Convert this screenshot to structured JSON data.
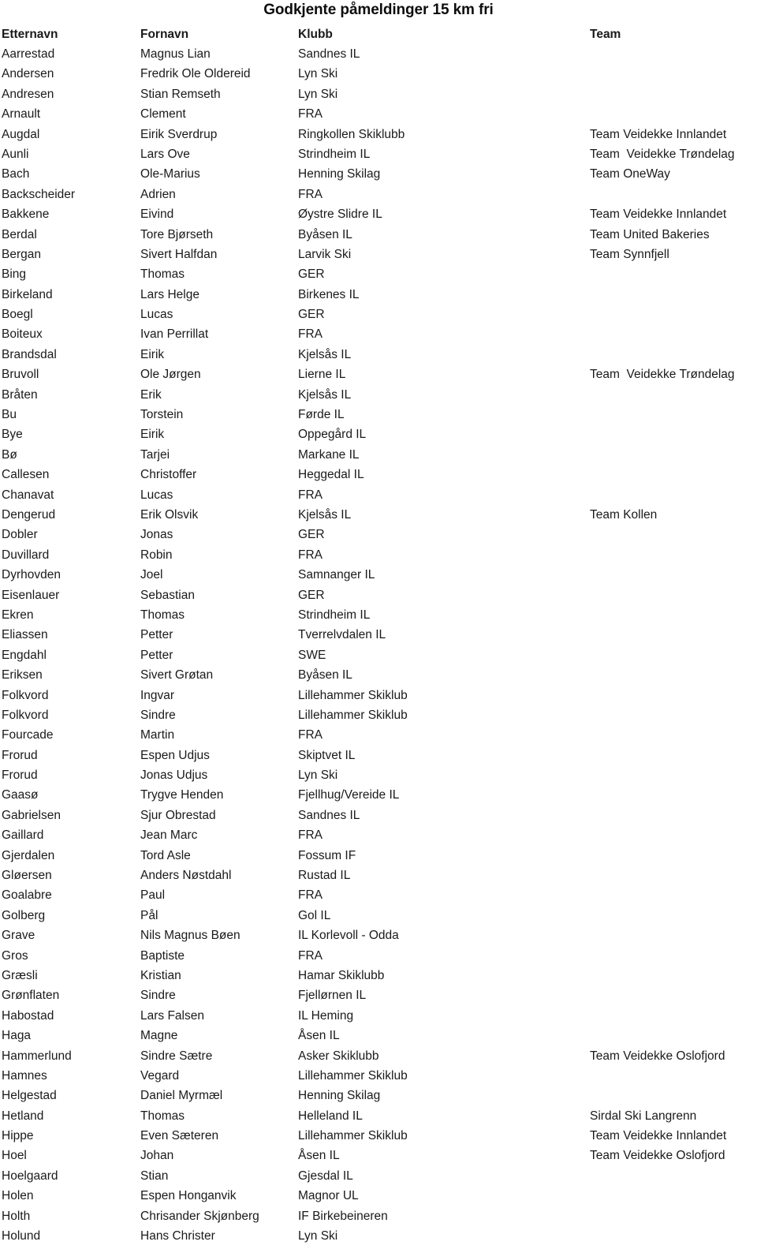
{
  "document": {
    "title": "Godkjente påmeldinger 15 km fri"
  },
  "table": {
    "columns": [
      {
        "key": "etternavn",
        "label": "Etternavn"
      },
      {
        "key": "fornavn",
        "label": "Fornavn"
      },
      {
        "key": "klubb",
        "label": "Klubb"
      },
      {
        "key": "team",
        "label": "Team"
      }
    ],
    "rows": [
      {
        "etternavn": "Aarrestad",
        "fornavn": "Magnus Lian",
        "klubb": "Sandnes IL",
        "team": ""
      },
      {
        "etternavn": "Andersen",
        "fornavn": "Fredrik Ole Oldereid",
        "klubb": "Lyn Ski",
        "team": ""
      },
      {
        "etternavn": "Andresen",
        "fornavn": "Stian Remseth",
        "klubb": "Lyn Ski",
        "team": ""
      },
      {
        "etternavn": "Arnault",
        "fornavn": "Clement",
        "klubb": "FRA",
        "team": ""
      },
      {
        "etternavn": "Augdal",
        "fornavn": "Eirik Sverdrup",
        "klubb": "Ringkollen Skiklubb",
        "team": "Team Veidekke Innlandet"
      },
      {
        "etternavn": "Aunli",
        "fornavn": "Lars Ove",
        "klubb": "Strindheim IL",
        "team": "Team  Veidekke Trøndelag"
      },
      {
        "etternavn": "Bach",
        "fornavn": "Ole-Marius",
        "klubb": "Henning Skilag",
        "team": "Team OneWay"
      },
      {
        "etternavn": "Backscheider",
        "fornavn": "Adrien",
        "klubb": "FRA",
        "team": ""
      },
      {
        "etternavn": "Bakkene",
        "fornavn": "Eivind",
        "klubb": "Øystre Slidre IL",
        "team": "Team Veidekke Innlandet"
      },
      {
        "etternavn": "Berdal",
        "fornavn": "Tore Bjørseth",
        "klubb": "Byåsen IL",
        "team": "Team United Bakeries"
      },
      {
        "etternavn": "Bergan",
        "fornavn": "Sivert Halfdan",
        "klubb": "Larvik Ski",
        "team": "Team Synnfjell"
      },
      {
        "etternavn": "Bing",
        "fornavn": "Thomas",
        "klubb": "GER",
        "team": ""
      },
      {
        "etternavn": "Birkeland",
        "fornavn": "Lars Helge",
        "klubb": "Birkenes IL",
        "team": ""
      },
      {
        "etternavn": "Boegl",
        "fornavn": "Lucas",
        "klubb": "GER",
        "team": ""
      },
      {
        "etternavn": "Boiteux",
        "fornavn": "Ivan Perrillat",
        "klubb": "FRA",
        "team": ""
      },
      {
        "etternavn": "Brandsdal",
        "fornavn": "Eirik",
        "klubb": "Kjelsås IL",
        "team": ""
      },
      {
        "etternavn": "Bruvoll",
        "fornavn": "Ole Jørgen",
        "klubb": "Lierne IL",
        "team": "Team  Veidekke Trøndelag"
      },
      {
        "etternavn": "Bråten",
        "fornavn": "Erik",
        "klubb": "Kjelsås IL",
        "team": ""
      },
      {
        "etternavn": "Bu",
        "fornavn": "Torstein",
        "klubb": "Førde IL",
        "team": ""
      },
      {
        "etternavn": "Bye",
        "fornavn": "Eirik",
        "klubb": "Oppegård IL",
        "team": ""
      },
      {
        "etternavn": "Bø",
        "fornavn": "Tarjei",
        "klubb": "Markane IL",
        "team": ""
      },
      {
        "etternavn": "Callesen",
        "fornavn": "Christoffer",
        "klubb": "Heggedal IL",
        "team": ""
      },
      {
        "etternavn": "Chanavat",
        "fornavn": "Lucas",
        "klubb": "FRA",
        "team": ""
      },
      {
        "etternavn": "Dengerud",
        "fornavn": "Erik Olsvik",
        "klubb": "Kjelsås IL",
        "team": "Team Kollen"
      },
      {
        "etternavn": "Dobler",
        "fornavn": "Jonas",
        "klubb": "GER",
        "team": ""
      },
      {
        "etternavn": "Duvillard",
        "fornavn": "Robin",
        "klubb": "FRA",
        "team": ""
      },
      {
        "etternavn": "Dyrhovden",
        "fornavn": "Joel",
        "klubb": "Samnanger IL",
        "team": ""
      },
      {
        "etternavn": "Eisenlauer",
        "fornavn": "Sebastian",
        "klubb": "GER",
        "team": ""
      },
      {
        "etternavn": "Ekren",
        "fornavn": "Thomas",
        "klubb": "Strindheim IL",
        "team": ""
      },
      {
        "etternavn": "Eliassen",
        "fornavn": "Petter",
        "klubb": "Tverrelvdalen IL",
        "team": ""
      },
      {
        "etternavn": "Engdahl",
        "fornavn": "Petter",
        "klubb": "SWE",
        "team": ""
      },
      {
        "etternavn": "Eriksen",
        "fornavn": "Sivert Grøtan",
        "klubb": "Byåsen IL",
        "team": ""
      },
      {
        "etternavn": "Folkvord",
        "fornavn": "Ingvar",
        "klubb": "Lillehammer Skiklub",
        "team": ""
      },
      {
        "etternavn": "Folkvord",
        "fornavn": "Sindre",
        "klubb": "Lillehammer Skiklub",
        "team": ""
      },
      {
        "etternavn": "Fourcade",
        "fornavn": "Martin",
        "klubb": "FRA",
        "team": ""
      },
      {
        "etternavn": "Frorud",
        "fornavn": "Espen Udjus",
        "klubb": "Skiptvet IL",
        "team": ""
      },
      {
        "etternavn": "Frorud",
        "fornavn": "Jonas Udjus",
        "klubb": "Lyn Ski",
        "team": ""
      },
      {
        "etternavn": "Gaasø",
        "fornavn": "Trygve Henden",
        "klubb": "Fjellhug/Vereide IL",
        "team": ""
      },
      {
        "etternavn": "Gabrielsen",
        "fornavn": "Sjur Obrestad",
        "klubb": "Sandnes IL",
        "team": ""
      },
      {
        "etternavn": "Gaillard",
        "fornavn": "Jean Marc",
        "klubb": "FRA",
        "team": ""
      },
      {
        "etternavn": "Gjerdalen",
        "fornavn": "Tord Asle",
        "klubb": "Fossum IF",
        "team": ""
      },
      {
        "etternavn": "Gløersen",
        "fornavn": "Anders Nøstdahl",
        "klubb": "Rustad IL",
        "team": ""
      },
      {
        "etternavn": "Goalabre",
        "fornavn": "Paul",
        "klubb": "FRA",
        "team": ""
      },
      {
        "etternavn": "Golberg",
        "fornavn": "Pål",
        "klubb": "Gol IL",
        "team": ""
      },
      {
        "etternavn": "Grave",
        "fornavn": "Nils Magnus Bøen",
        "klubb": "IL Korlevoll - Odda",
        "team": ""
      },
      {
        "etternavn": "Gros",
        "fornavn": "Baptiste",
        "klubb": "FRA",
        "team": ""
      },
      {
        "etternavn": "Græsli",
        "fornavn": "Kristian",
        "klubb": "Hamar Skiklubb",
        "team": ""
      },
      {
        "etternavn": "Grønflaten",
        "fornavn": "Sindre",
        "klubb": "Fjellørnen IL",
        "team": ""
      },
      {
        "etternavn": "Habostad",
        "fornavn": "Lars Falsen",
        "klubb": "IL Heming",
        "team": ""
      },
      {
        "etternavn": "Haga",
        "fornavn": "Magne",
        "klubb": "Åsen IL",
        "team": ""
      },
      {
        "etternavn": "Hammerlund",
        "fornavn": "Sindre Sætre",
        "klubb": "Asker Skiklubb",
        "team": "Team Veidekke Oslofjord"
      },
      {
        "etternavn": "Hamnes",
        "fornavn": "Vegard",
        "klubb": "Lillehammer Skiklub",
        "team": ""
      },
      {
        "etternavn": "Helgestad",
        "fornavn": "Daniel Myrmæl",
        "klubb": "Henning Skilag",
        "team": ""
      },
      {
        "etternavn": "Hetland",
        "fornavn": "Thomas",
        "klubb": "Helleland IL",
        "team": "Sirdal Ski Langrenn"
      },
      {
        "etternavn": "Hippe",
        "fornavn": "Even Sæteren",
        "klubb": "Lillehammer Skiklub",
        "team": "Team Veidekke Innlandet"
      },
      {
        "etternavn": "Hoel",
        "fornavn": "Johan",
        "klubb": "Åsen IL",
        "team": "Team Veidekke Oslofjord"
      },
      {
        "etternavn": "Hoelgaard",
        "fornavn": "Stian",
        "klubb": "Gjesdal IL",
        "team": ""
      },
      {
        "etternavn": "Holen",
        "fornavn": "Espen Honganvik",
        "klubb": "Magnor UL",
        "team": ""
      },
      {
        "etternavn": "Holth",
        "fornavn": "Chrisander Skjønberg",
        "klubb": "IF Birkebeineren",
        "team": ""
      },
      {
        "etternavn": "Holund",
        "fornavn": "Hans Christer",
        "klubb": "Lyn Ski",
        "team": ""
      }
    ]
  }
}
